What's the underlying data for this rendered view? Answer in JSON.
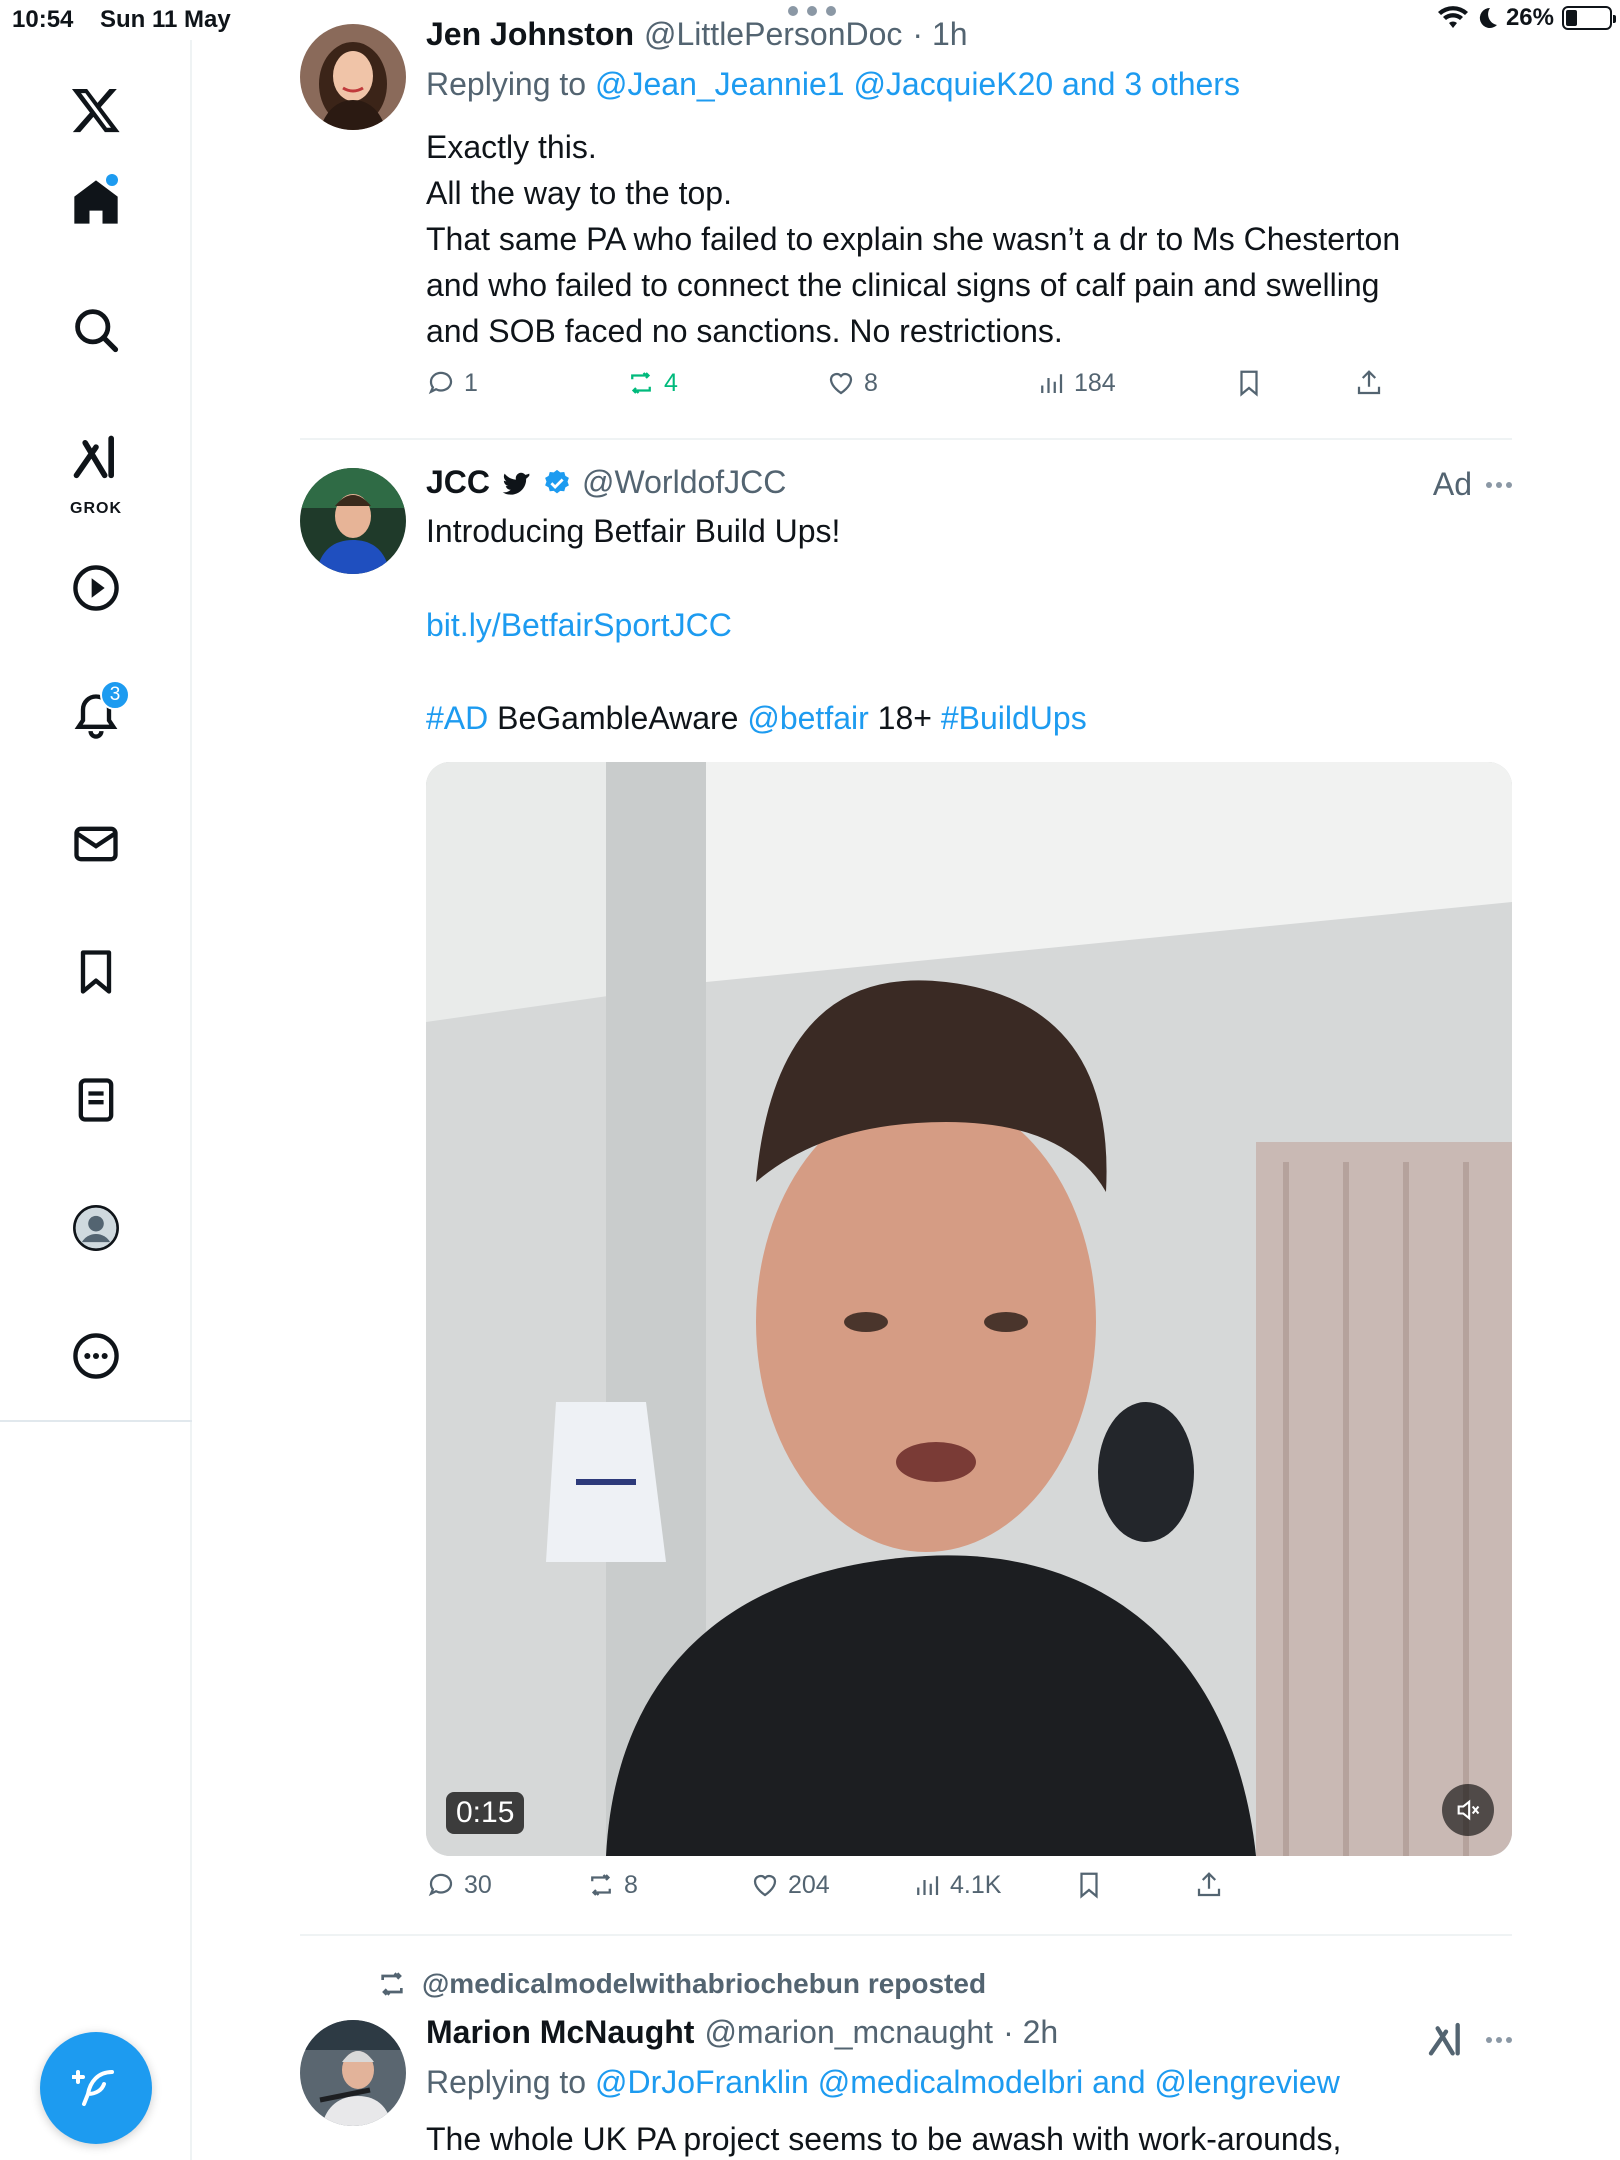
{
  "status_bar": {
    "time": "10:54",
    "date": "Sun 11 May",
    "battery": "26%",
    "battery_level": 0.26
  },
  "sidebar": {
    "items": [
      {
        "name": "x-logo",
        "label": ""
      },
      {
        "name": "home",
        "label": ""
      },
      {
        "name": "search",
        "label": ""
      },
      {
        "name": "grok",
        "label": "GROK"
      },
      {
        "name": "video",
        "label": ""
      },
      {
        "name": "notifications",
        "label": "",
        "badge": "3"
      },
      {
        "name": "messages",
        "label": ""
      },
      {
        "name": "bookmarks",
        "label": ""
      },
      {
        "name": "lists",
        "label": ""
      },
      {
        "name": "profile",
        "label": ""
      },
      {
        "name": "more",
        "label": ""
      }
    ]
  },
  "tweets": [
    {
      "name": "Jen Johnston",
      "handle": "@LittlePersonDoc",
      "time": "· 1h",
      "reply_prefix": "Replying to",
      "reply_to": "@Jean_Jeannie1 @JacquieK20 and 3 others",
      "body": [
        "Exactly this.",
        "All the way to the top.",
        "That same PA who failed to explain she wasn’t a dr to Ms Chesterton",
        "and who failed to connect the clinical signs of calf pain and swelling",
        "and SOB faced no sanctions. No restrictions."
      ],
      "stats": {
        "replies": "1",
        "reposts": "4",
        "likes": "8",
        "views": "184"
      }
    },
    {
      "name": "JCC",
      "handle": "@WorldofJCC",
      "ad_label": "Ad",
      "body_intro": "Introducing Betfair Build Ups!",
      "link": "bit.ly/BetfairSportJCC",
      "tags": {
        "ad": "#AD",
        "aware": "BeGambleAware",
        "mention": "@betfair",
        "age": "18+",
        "hashtag": "#BuildUps"
      },
      "video_duration": "0:15",
      "stats": {
        "replies": "30",
        "reposts": "8",
        "likes": "204",
        "views": "4.1K"
      }
    },
    {
      "repost_line": "@medicalmodelwithabriochebun reposted",
      "name": "Marion McNaught",
      "handle": "@marion_mcnaught",
      "time": "· 2h",
      "reply_prefix": "Replying to",
      "reply_to": "@DrJoFranklin @medicalmodelbri and @lengreview",
      "body": [
        "The whole UK PA project seems to be awash with work-arounds,"
      ]
    }
  ],
  "colors": {
    "accent": "#1d9bf0",
    "text": "#0f1419",
    "muted": "#536471",
    "repost_active": "#00ba7c"
  }
}
